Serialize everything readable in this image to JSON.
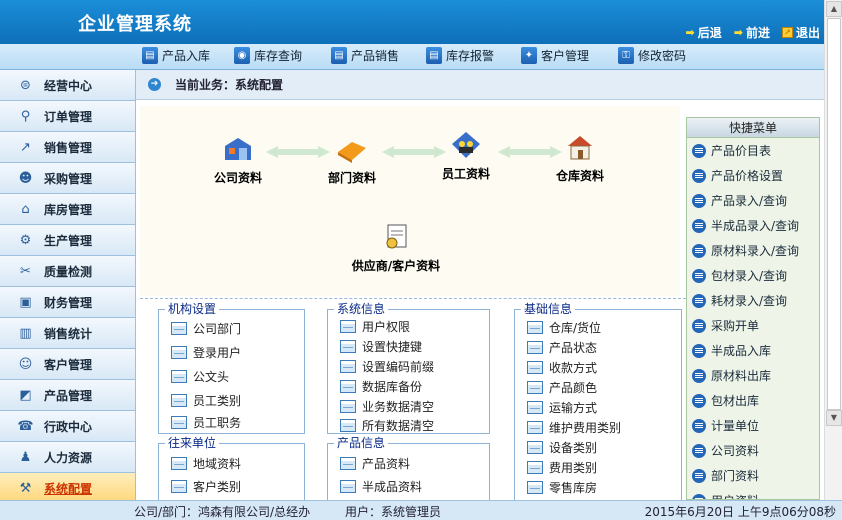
{
  "header": {
    "title": "企业管理系统",
    "nav": [
      {
        "label": "后退",
        "icon": "back-arrow-icon"
      },
      {
        "label": "前进",
        "icon": "forward-arrow-icon"
      },
      {
        "label": "退出",
        "icon": "exit-icon"
      }
    ]
  },
  "toolbar": {
    "items": [
      {
        "label": "产品入库",
        "icon": "product-inbound-icon"
      },
      {
        "label": "库存查询",
        "icon": "stock-query-icon"
      },
      {
        "label": "产品销售",
        "icon": "product-sales-icon"
      },
      {
        "label": "库存报警",
        "icon": "stock-alarm-icon"
      },
      {
        "label": "客户管理",
        "icon": "customer-icon"
      },
      {
        "label": "修改密码",
        "icon": "key-icon"
      }
    ]
  },
  "sidebar": {
    "items": [
      {
        "label": "经营中心",
        "icon": "business-center-icon"
      },
      {
        "label": "订单管理",
        "icon": "order-search-icon"
      },
      {
        "label": "销售管理",
        "icon": "sales-chart-icon"
      },
      {
        "label": "采购管理",
        "icon": "purchase-people-icon"
      },
      {
        "label": "库房管理",
        "icon": "warehouse-icon"
      },
      {
        "label": "生产管理",
        "icon": "production-icon"
      },
      {
        "label": "质量检测",
        "icon": "quality-icon"
      },
      {
        "label": "财务管理",
        "icon": "finance-icon"
      },
      {
        "label": "销售统计",
        "icon": "bar-chart-icon"
      },
      {
        "label": "客户管理",
        "icon": "customers-icon"
      },
      {
        "label": "产品管理",
        "icon": "product-chart-icon"
      },
      {
        "label": "行政中心",
        "icon": "admin-phone-icon"
      },
      {
        "label": "人力资源",
        "icon": "hr-people-icon"
      },
      {
        "label": "系统配置",
        "icon": "tools-icon",
        "active": true
      }
    ]
  },
  "current": {
    "label": "当前业务：系统配置"
  },
  "diagram": {
    "company": "公司资料",
    "department": "部门资料",
    "employee": "员工资料",
    "warehouse": "仓库资料",
    "supplier": "供应商/客户资料"
  },
  "groups": {
    "org": {
      "title": "机构设置",
      "items": [
        "公司部门",
        "登录用户",
        "公文头",
        "员工类别",
        "员工职务"
      ]
    },
    "system": {
      "title": "系统信息",
      "items": [
        "用户权限",
        "设置快捷键",
        "设置编码前缀",
        "数据库备份",
        "业务数据清空",
        "所有数据清空"
      ]
    },
    "base": {
      "title": "基础信息",
      "items": [
        "仓库/货位",
        "产品状态",
        "收款方式",
        "产品颜色",
        "运输方式",
        "维护费用类别",
        "设备类别",
        "费用类别",
        "零售库房"
      ]
    },
    "contact": {
      "title": "往来单位",
      "items": [
        "地域资料",
        "客户类别"
      ]
    },
    "product": {
      "title": "产品信息",
      "items": [
        "产品资料",
        "半成品资料"
      ]
    }
  },
  "quick": {
    "title": "快捷菜单",
    "items": [
      "产品价目表",
      "产品价格设置",
      "产品录入/查询",
      "半成品录入/查询",
      "原材料录入/查询",
      "包材录入/查询",
      "耗材录入/查询",
      "采购开单",
      "半成品入库",
      "原材料出库",
      "包材出库",
      "计量单位",
      "公司资料",
      "部门资料",
      "用户资料"
    ]
  },
  "status": {
    "company": "公司/部门：鸿森有限公司/总经办",
    "user": "用户：系统管理员",
    "datetime": "2015年6月20日  上午9点06分08秒"
  },
  "colors": {
    "header": "#1b8ed8",
    "accent": "#2466b8",
    "active": "#ffd67a"
  }
}
